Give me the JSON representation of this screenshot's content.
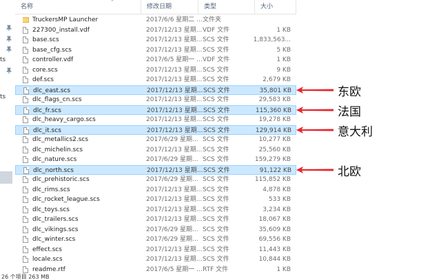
{
  "header": {
    "columns": [
      {
        "key": "name",
        "label": "名称"
      },
      {
        "key": "date",
        "label": "修改日期"
      },
      {
        "key": "type",
        "label": "类型"
      },
      {
        "key": "size",
        "label": "大小"
      }
    ]
  },
  "sidebar": {
    "cut_labels": [
      "ts",
      "ts"
    ]
  },
  "files": [
    {
      "name": "TruckersMP Launcher",
      "date": "2017/6/6 星期二 ...",
      "type": "文件夹",
      "size": "",
      "icon": "folder-icon",
      "selected": false
    },
    {
      "name": "227300_install.vdf",
      "date": "2017/12/13 星期...",
      "type": "VDF 文件",
      "size": "1 KB",
      "icon": "file-icon",
      "selected": false
    },
    {
      "name": "base.scs",
      "date": "2017/12/13 星期...",
      "type": "SCS 文件",
      "size": "1,833,563...",
      "icon": "file-icon",
      "selected": false
    },
    {
      "name": "base_cfg.scs",
      "date": "2017/12/13 星期...",
      "type": "SCS 文件",
      "size": "5 KB",
      "icon": "file-icon",
      "selected": false
    },
    {
      "name": "controller.vdf",
      "date": "2017/6/5 星期一 ...",
      "type": "VDF 文件",
      "size": "1 KB",
      "icon": "file-icon",
      "selected": false
    },
    {
      "name": "core.scs",
      "date": "2017/12/13 星期...",
      "type": "SCS 文件",
      "size": "9 KB",
      "icon": "file-icon",
      "selected": false
    },
    {
      "name": "def.scs",
      "date": "2017/12/13 星期...",
      "type": "SCS 文件",
      "size": "2,679 KB",
      "icon": "file-icon",
      "selected": false
    },
    {
      "name": "dlc_east.scs",
      "date": "2017/12/13 星期...",
      "type": "SCS 文件",
      "size": "35,801 KB",
      "icon": "file-icon",
      "selected": true
    },
    {
      "name": "dlc_flags_cn.scs",
      "date": "2017/12/13 星期...",
      "type": "SCS 文件",
      "size": "29,583 KB",
      "icon": "file-icon",
      "selected": false
    },
    {
      "name": "dlc_fr.scs",
      "date": "2017/12/13 星期...",
      "type": "SCS 文件",
      "size": "115,360 KB",
      "icon": "file-icon",
      "selected": true
    },
    {
      "name": "dlc_heavy_cargo.scs",
      "date": "2017/12/13 星期...",
      "type": "SCS 文件",
      "size": "19,278 KB",
      "icon": "file-icon",
      "selected": false
    },
    {
      "name": "dlc_it.scs",
      "date": "2017/12/13 星期...",
      "type": "SCS 文件",
      "size": "129,914 KB",
      "icon": "file-icon",
      "selected": true
    },
    {
      "name": "dlc_metallics2.scs",
      "date": "2017/6/29 星期...",
      "type": "SCS 文件",
      "size": "10,277 KB",
      "icon": "file-icon",
      "selected": false
    },
    {
      "name": "dlc_michelin.scs",
      "date": "2017/12/13 星期...",
      "type": "SCS 文件",
      "size": "25,560 KB",
      "icon": "file-icon",
      "selected": false
    },
    {
      "name": "dlc_nature.scs",
      "date": "2017/6/29 星期...",
      "type": "SCS 文件",
      "size": "159,279 KB",
      "icon": "file-icon",
      "selected": false
    },
    {
      "name": "dlc_north.scs",
      "date": "2017/12/13 星期...",
      "type": "SCS 文件",
      "size": "91,122 KB",
      "icon": "file-icon",
      "selected": true
    },
    {
      "name": "dlc_prehistoric.scs",
      "date": "2017/6/29 星期...",
      "type": "SCS 文件",
      "size": "115,852 KB",
      "icon": "file-icon",
      "selected": false
    },
    {
      "name": "dlc_rims.scs",
      "date": "2017/12/13 星期...",
      "type": "SCS 文件",
      "size": "4,878 KB",
      "icon": "file-icon",
      "selected": false
    },
    {
      "name": "dlc_rocket_league.scs",
      "date": "2017/12/13 星期...",
      "type": "SCS 文件",
      "size": "533 KB",
      "icon": "file-icon",
      "selected": false
    },
    {
      "name": "dlc_toys.scs",
      "date": "2017/12/13 星期...",
      "type": "SCS 文件",
      "size": "3,234 KB",
      "icon": "file-icon",
      "selected": false
    },
    {
      "name": "dlc_trailers.scs",
      "date": "2017/12/13 星期...",
      "type": "SCS 文件",
      "size": "18,067 KB",
      "icon": "file-icon",
      "selected": false
    },
    {
      "name": "dlc_vikings.scs",
      "date": "2017/6/29 星期...",
      "type": "SCS 文件",
      "size": "35,609 KB",
      "icon": "file-icon",
      "selected": false
    },
    {
      "name": "dlc_winter.scs",
      "date": "2017/6/29 星期...",
      "type": "SCS 文件",
      "size": "69,556 KB",
      "icon": "file-icon",
      "selected": false
    },
    {
      "name": "effect.scs",
      "date": "2017/12/13 星期...",
      "type": "SCS 文件",
      "size": "11,443 KB",
      "icon": "file-icon",
      "selected": false
    },
    {
      "name": "locale.scs",
      "date": "2017/12/13 星期...",
      "type": "SCS 文件",
      "size": "10,844 KB",
      "icon": "file-icon",
      "selected": false
    },
    {
      "name": "readme.rtf",
      "date": "2017/6/5 星期一 ...",
      "type": "RTF 文件",
      "size": "1 KB",
      "icon": "file-icon",
      "selected": false
    }
  ],
  "annotations": [
    {
      "label": "东欧",
      "row": 7
    },
    {
      "label": "法国",
      "row": 9
    },
    {
      "label": "意大利",
      "row": 11
    },
    {
      "label": "北欧",
      "row": 15
    }
  ],
  "statusbar": {
    "text": "26 个项目  263 MB"
  },
  "colors": {
    "selection_bg": "#cce8ff",
    "selection_border": "#99d1ff",
    "arrow": "#e8262b",
    "folder": "#f8d775"
  }
}
